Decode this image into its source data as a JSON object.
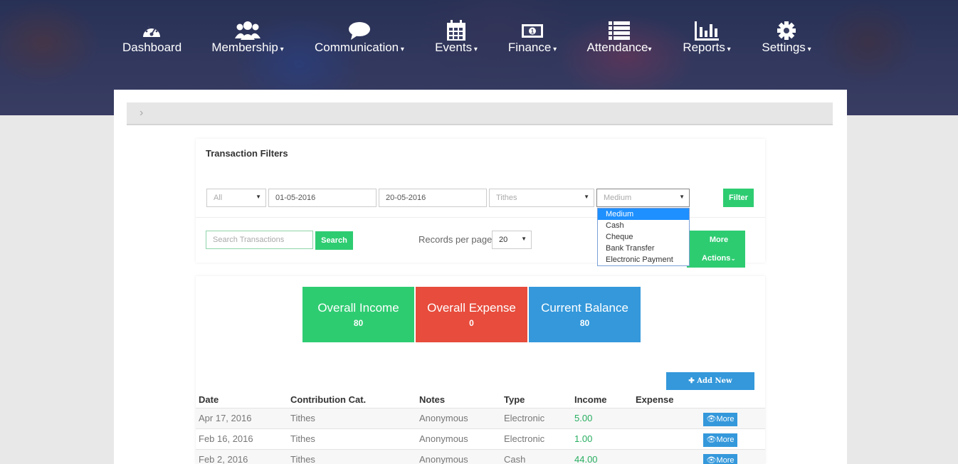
{
  "nav": [
    {
      "label": "Dashboard",
      "caret": "",
      "icon": "dashboard-icon"
    },
    {
      "label": "Membership",
      "caret": " ▾",
      "icon": "members-icon"
    },
    {
      "label": "Communication",
      "caret": " ▾",
      "icon": "chat-icon"
    },
    {
      "label": "Events",
      "caret": " ▾",
      "icon": "calendar-icon"
    },
    {
      "label": "Finance",
      "caret": " ▾",
      "icon": "money-icon"
    },
    {
      "label": "Attendance",
      "caret": "▾",
      "icon": "list-icon"
    },
    {
      "label": "Reports",
      "caret": " ▾",
      "icon": "bar-chart-icon"
    },
    {
      "label": "Settings",
      "caret": " ▾",
      "icon": "gear-icon"
    }
  ],
  "filters": {
    "title": "Transaction Filters",
    "type_select": "All",
    "date_from": "01-05-2016",
    "date_to": "20-05-2016",
    "category_select": "Tithes",
    "medium_select": "Medium",
    "filter_button": "Filter",
    "medium_options": [
      "Medium",
      "Cash",
      "Cheque",
      "Bank Transfer",
      "Electronic Payment"
    ],
    "search_placeholder": "Search Transactions",
    "search_button": "Search",
    "records_label": "Records per page",
    "records_value": "20",
    "more_actions": "More Actions"
  },
  "summary": {
    "income": {
      "title": "Overall Income",
      "value": "80"
    },
    "expense": {
      "title": "Overall Expense",
      "value": "0"
    },
    "balance": {
      "title": "Current Balance",
      "value": "80"
    }
  },
  "add_transaction": "✚ Add New Transaction",
  "table": {
    "headers": [
      "Date",
      "Contribution Cat.",
      "Notes",
      "Type",
      "Income",
      "Expense"
    ],
    "more_label": "More",
    "rows": [
      {
        "date": "Apr 17, 2016",
        "category": "Tithes",
        "notes": "Anonymous",
        "type": "Electronic",
        "income": "5.00",
        "expense": ""
      },
      {
        "date": "Feb 16, 2016",
        "category": "Tithes",
        "notes": "Anonymous",
        "type": "Electronic",
        "income": "1.00",
        "expense": ""
      },
      {
        "date": "Feb 2, 2016",
        "category": "Tithes",
        "notes": "Anonymous",
        "type": "Cash",
        "income": "44.00",
        "expense": ""
      }
    ]
  },
  "colors": {
    "green": "#2ecc71",
    "red": "#e74c3c",
    "blue": "#3498db"
  }
}
